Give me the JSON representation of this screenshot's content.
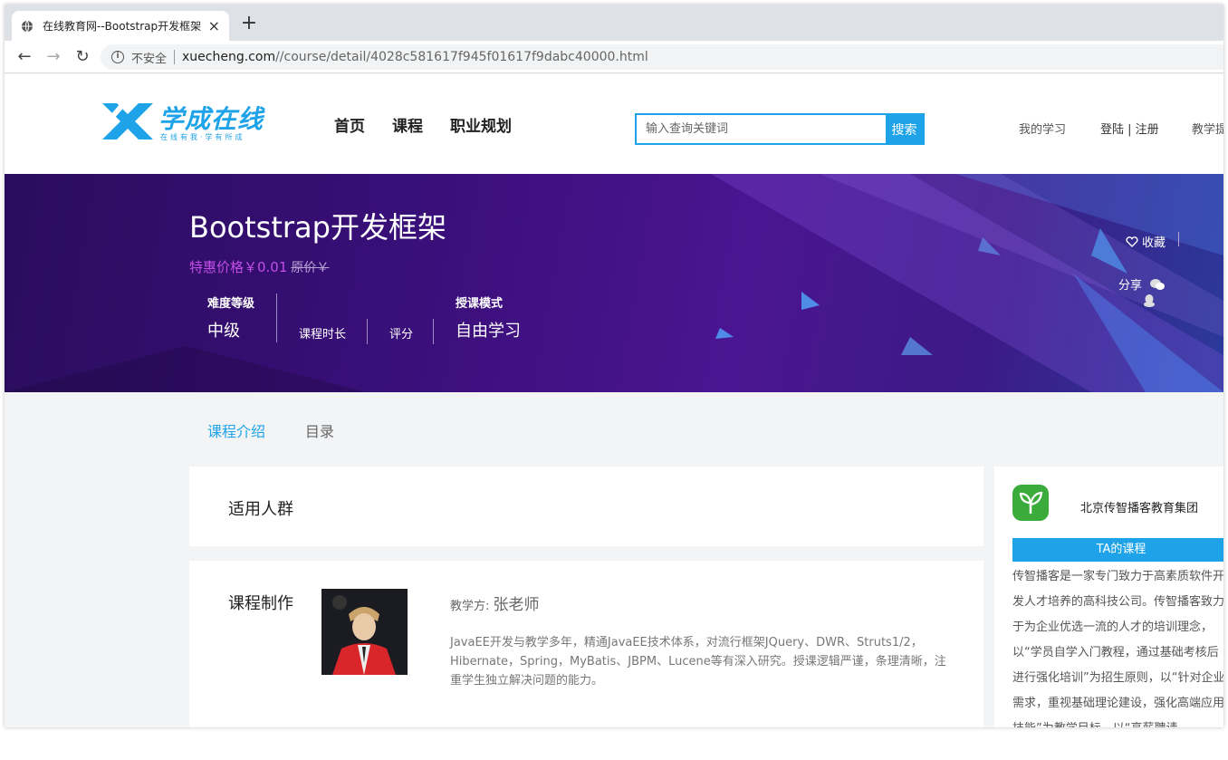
{
  "browser": {
    "tab_title": "在线教育网--Bootstrap开发框架",
    "tab_close": "×",
    "new_tab": "+",
    "back": "←",
    "forward": "→",
    "reload": "↻",
    "info": "i",
    "security": "不安全",
    "url_host": "xuecheng.com",
    "url_path": "//course/detail/4028c581617f945f01617f9dabc40000.html"
  },
  "site": {
    "logo_text": "学成在线",
    "logo_sub": "在线有我·学有所成",
    "nav": [
      "首页",
      "课程",
      "职业规划"
    ],
    "search_placeholder": "输入查询关键词",
    "search_button": "搜索",
    "my_study": "我的学习",
    "login": "登陆 | 注册",
    "teach": "教学提"
  },
  "banner": {
    "title": "Bootstrap开发框架",
    "sale_price": "特惠价格￥0.01",
    "orig_price": "原价￥",
    "difficulty_label": "难度等级",
    "difficulty_value": "中级",
    "duration_label": "课程时长",
    "rating_label": "评分",
    "mode_label": "授课模式",
    "mode_value": "自由学习",
    "favorite": "收藏",
    "share": "分享"
  },
  "tabs": {
    "intro": "课程介绍",
    "catalog": "目录"
  },
  "audience": {
    "heading": "适用人群"
  },
  "author": {
    "heading": "课程制作",
    "teacher_prefix": "教学方: ",
    "teacher_name": "张老师",
    "bio": "JavaEE开发与教学多年，精通JavaEE技术体系，对流行框架JQuery、DWR、Struts1/2，Hibernate，Spring，MyBatis、JBPM、Lucene等有深入研究。授课逻辑严谨，条理清晰，注重学生独立解决问题的能力。"
  },
  "org": {
    "name": "北京传智播客教育集团",
    "button": "TA的课程",
    "desc": "传智播客是一家专门致力于高素质软件开发人才培养的高科技公司。传智播客致力于为企业优选一流的人才的培训理念，以“学员自学入门教程，通过基础考核后进行强化培训”为招生原则，以“针对企业需求，重视基础理论建设，强化高端应用技能”为教学目标，以“高薪聘请"
  },
  "colors": {
    "accent": "#1fa3e8",
    "banner_start": "#2a0d5e",
    "banner_end": "#2b3a9a",
    "sale": "#c34ee6",
    "org_logo": "#3bab3b"
  }
}
